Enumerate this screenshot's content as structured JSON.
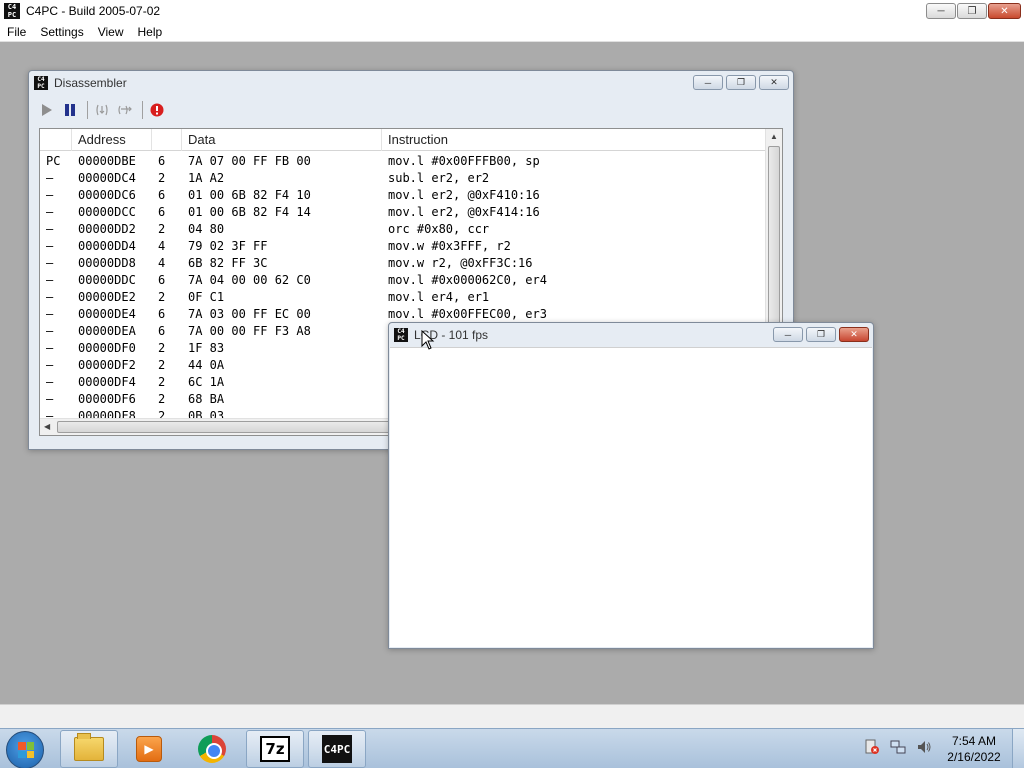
{
  "app": {
    "title": "C4PC - Build 2005-07-02",
    "icon_text": "C4PC",
    "minimize": "─",
    "maximize": "❐",
    "close": "✕"
  },
  "menu": [
    "File",
    "Settings",
    "View",
    "Help"
  ],
  "disassembler": {
    "title": "Disassembler",
    "columns": [
      "Address",
      "Data",
      "Instruction"
    ],
    "rows": [
      {
        "mark": "PC",
        "addr": "00000DBE",
        "len": "6",
        "data": "7A 07 00 FF FB 00",
        "ins": "mov.l #0x00FFFB00, sp"
      },
      {
        "mark": "–",
        "addr": "00000DC4",
        "len": "2",
        "data": "1A A2",
        "ins": "sub.l er2, er2"
      },
      {
        "mark": "–",
        "addr": "00000DC6",
        "len": "6",
        "data": "01 00 6B 82 F4 10",
        "ins": "mov.l er2, @0xF410:16"
      },
      {
        "mark": "–",
        "addr": "00000DCC",
        "len": "6",
        "data": "01 00 6B 82 F4 14",
        "ins": "mov.l er2, @0xF414:16"
      },
      {
        "mark": "–",
        "addr": "00000DD2",
        "len": "2",
        "data": "04 80",
        "ins": "orc #0x80, ccr"
      },
      {
        "mark": "–",
        "addr": "00000DD4",
        "len": "4",
        "data": "79 02 3F FF",
        "ins": "mov.w #0x3FFF, r2"
      },
      {
        "mark": "–",
        "addr": "00000DD8",
        "len": "4",
        "data": "6B 82 FF 3C",
        "ins": "mov.w r2, @0xFF3C:16"
      },
      {
        "mark": "–",
        "addr": "00000DDC",
        "len": "6",
        "data": "7A 04 00 00 62 C0",
        "ins": "mov.l #0x000062C0, er4"
      },
      {
        "mark": "–",
        "addr": "00000DE2",
        "len": "2",
        "data": "0F C1",
        "ins": "mov.l er4, er1"
      },
      {
        "mark": "–",
        "addr": "00000DE4",
        "len": "6",
        "data": "7A 03 00 FF EC 00",
        "ins": "mov.l #0x00FFEC00, er3"
      },
      {
        "mark": "–",
        "addr": "00000DEA",
        "len": "6",
        "data": "7A 00 00 FF F3 A8",
        "ins": ""
      },
      {
        "mark": "–",
        "addr": "00000DF0",
        "len": "2",
        "data": "1F 83",
        "ins": ""
      },
      {
        "mark": "–",
        "addr": "00000DF2",
        "len": "2",
        "data": "44 0A",
        "ins": ""
      },
      {
        "mark": "–",
        "addr": "00000DF4",
        "len": "2",
        "data": "6C 1A",
        "ins": ""
      },
      {
        "mark": "–",
        "addr": "00000DF6",
        "len": "2",
        "data": "68 BA",
        "ins": ""
      },
      {
        "mark": "–",
        "addr": "00000DF8",
        "len": "2",
        "data": "0B 03",
        "ins": ""
      }
    ]
  },
  "lcd": {
    "title": "LCD - 101 fps"
  },
  "taskbar": {
    "sevenzip_label": "7z",
    "c4pc_label": "C4PC",
    "clock_time": "7:54 AM",
    "clock_date": "2/16/2022"
  },
  "colors": {
    "desktop_bg": "#ababab",
    "taskbar": "#b9cde3",
    "stop_red": "#d81e1e",
    "pause_blue": "#23328c"
  }
}
